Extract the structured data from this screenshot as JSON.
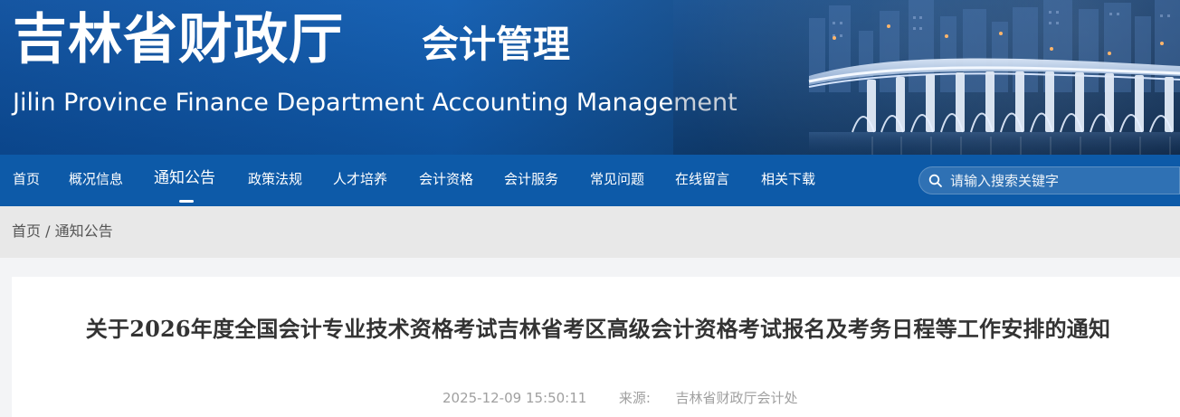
{
  "header": {
    "title_zh": "吉林省财政厅",
    "subtitle": "会计管理",
    "title_en": "Jilin Province Finance Department Accounting Management"
  },
  "nav": {
    "items": [
      {
        "label": "首页"
      },
      {
        "label": "概况信息"
      },
      {
        "label": "通知公告",
        "active": true
      },
      {
        "label": "政策法规"
      },
      {
        "label": "人才培养"
      },
      {
        "label": "会计资格"
      },
      {
        "label": "会计服务"
      },
      {
        "label": "常见问题"
      },
      {
        "label": "在线留言"
      },
      {
        "label": "相关下载"
      }
    ]
  },
  "search": {
    "placeholder": "请输入搜索关键字",
    "value": ""
  },
  "breadcrumb": {
    "home": "首页",
    "separator": "/",
    "current": "通知公告"
  },
  "article": {
    "title": "关于2026年度全国会计专业技术资格考试吉林省考区高级会计资格考试报名及考务日程等工作安排的通知",
    "date": "2025-12-09 15:50:11",
    "source_label": "来源:",
    "source": "吉林省财政厅会计处"
  },
  "colors": {
    "banner_blue": "#0f5cb1",
    "nav_blue": "#0d5aa8",
    "breadcrumb_bg": "#e8e8e8",
    "page_bg": "#f3f4f6",
    "title_text": "#333333",
    "meta_text": "#a0a0a0"
  },
  "icons": {
    "search": "search-icon"
  }
}
